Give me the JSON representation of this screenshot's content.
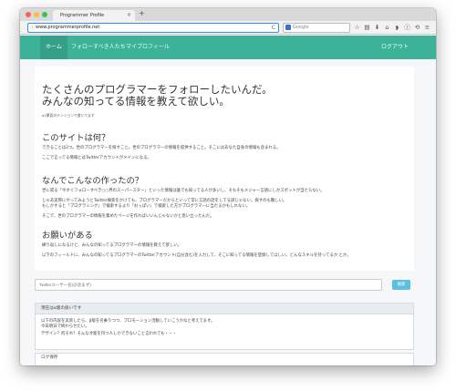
{
  "browser": {
    "tab_title": "Programmer Profile",
    "tab_close": "×",
    "new_tab": "+",
    "url": "www.programmerprofile.net",
    "reload_icon": "C",
    "search_placeholder": "Google",
    "toolbar_icons": [
      "star-icon",
      "reader-icon",
      "download-icon",
      "home-icon",
      "pocket-icon",
      "info-icon",
      "sync-icon",
      "menu-icon"
    ]
  },
  "nav": {
    "home": "ホーム",
    "follow": "フォローすべき人たち",
    "profile": "マイプロフィール",
    "logout": "ログアウト"
  },
  "hero": {
    "title_line1": "たくさんのプログラマーをフォローしたいんだ。",
    "title_line2": "みんなの知ってる情報を教えて欲しい。",
    "subtitle": "a2夢夏のテンションで書いてます"
  },
  "sections": [
    {
      "heading": "このサイトは何？",
      "paragraphs": [
        "できることは2つ。世のプログラマーを探すこと。世のプログラマーの情報を提供すること。そこにはあなた自身の情報も含まれる。",
        "ここで言ってる情報とはTwitterアカウントがメインになる。"
      ]
    },
    {
      "heading": "なんでこんなの作ったの？",
      "paragraphs": [
        "世に或る「今すぐフォローすべき○○界のスーパースター」といった情報は誰でも知ってる人が多いし、そもそもメジャー言語にしかスポットが当たらない。",
        "じゃあ実際にやってみようとTwitter検索をかけても、プログラマーだからといって常に言語の話をしてる訳じゃない。探すのも難しい。",
        "もしかすると「プログラミング」で検索するより「おっぱい」で検索した方がプログラマーに当たるかもしれない。",
        "そこで、世のプログラマーの情報を集めたページを作ればいいんじゃないかと思い立ったんだ。"
      ]
    },
    {
      "heading": "お願いがある",
      "paragraphs": [
        "繰り返しになるけど、みんなの知ってるプログラマーの情報を教えて欲しい。",
        "以下のフィールドに、みんなの知ってるプログラマーのTwitterアカウント(自分含む)を入力して、そこに知ってる情報を登録してほしい。どんなスキルを持ってるか とか。"
      ]
    }
  ],
  "search": {
    "placeholder": "Twitterユーザー名(@含まず)",
    "button": "検索"
  },
  "status": {
    "heading": "現在はα版の扱いです",
    "lines": [
      "以下の内容を実装したら、β版を名乗りつつ、プロモーション活動していこうかなと考えてます。",
      "今日明日で終わらせたい。",
      "デザイン？何それ？そんな才能を持つ人しかできないこと言われても・・・"
    ]
  },
  "log": {
    "label": "ログ保存"
  }
}
